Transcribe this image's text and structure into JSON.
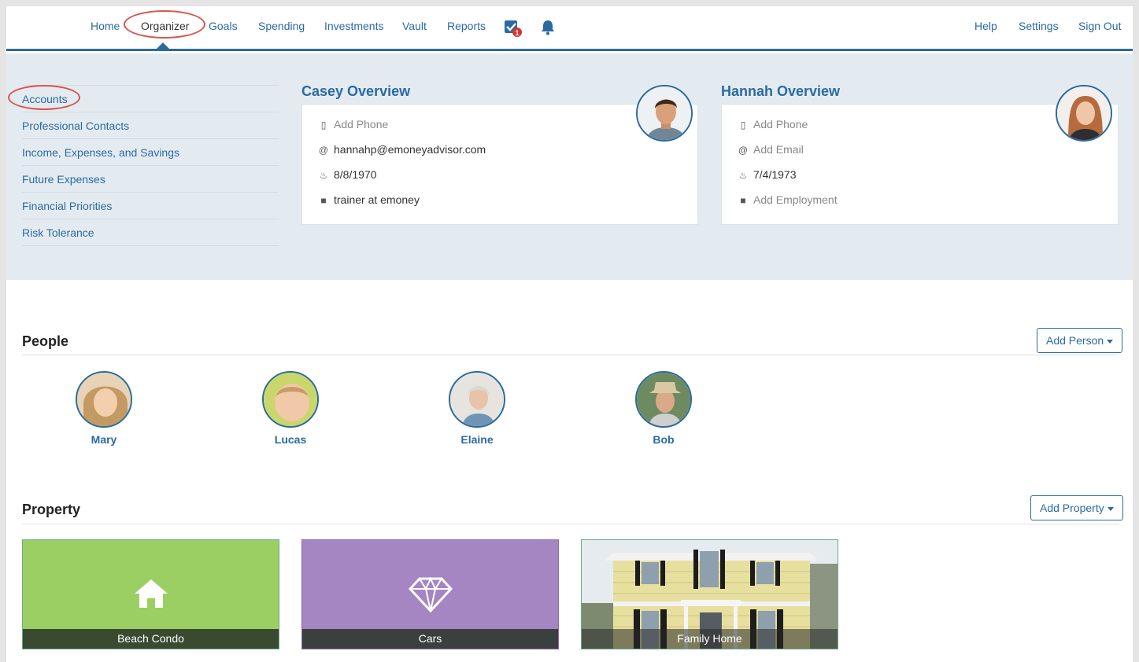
{
  "nav": {
    "home": "Home",
    "organizer": "Organizer",
    "goals": "Goals",
    "spending": "Spending",
    "investments": "Investments",
    "vault": "Vault",
    "reports": "Reports",
    "tasks_badge": "1",
    "help": "Help",
    "settings": "Settings",
    "sign_out": "Sign Out"
  },
  "sidebar": {
    "items": [
      {
        "label": "Accounts"
      },
      {
        "label": "Professional Contacts"
      },
      {
        "label": "Income, Expenses, and Savings"
      },
      {
        "label": "Future Expenses"
      },
      {
        "label": "Financial Priorities"
      },
      {
        "label": "Risk Tolerance"
      }
    ]
  },
  "casey": {
    "title": "Casey Overview",
    "phone": "Add Phone",
    "email": "hannahp@emoneyadvisor.com",
    "birthday": "8/8/1970",
    "employment": "trainer at emoney"
  },
  "hannah": {
    "title": "Hannah Overview",
    "phone": "Add Phone",
    "email": "Add Email",
    "birthday": "7/4/1973",
    "employment": "Add Employment"
  },
  "people": {
    "title": "People",
    "add_button": "Add Person",
    "list": [
      {
        "name": "Mary"
      },
      {
        "name": "Lucas"
      },
      {
        "name": "Elaine"
      },
      {
        "name": "Bob"
      }
    ]
  },
  "property": {
    "title": "Property",
    "add_button": "Add Property",
    "list": [
      {
        "name": "Beach Condo",
        "icon": "home-icon",
        "color": "#9ccf63"
      },
      {
        "name": "Cars",
        "icon": "diamond-icon",
        "color": "#a585c2"
      },
      {
        "name": "Family Home",
        "icon": "house-photo"
      }
    ]
  },
  "colors": {
    "accent": "#2a6aa3",
    "annotation": "#d9534f",
    "band": "#e4ebf0"
  }
}
